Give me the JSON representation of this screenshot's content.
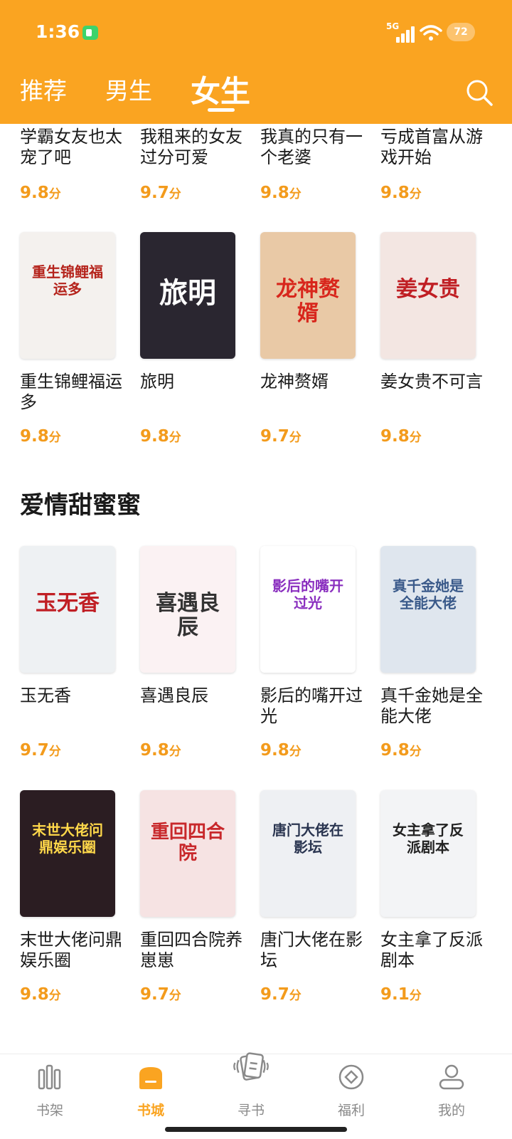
{
  "status": {
    "time": "1:36",
    "network": "5G",
    "battery": "72"
  },
  "tabs": [
    {
      "label": "推荐",
      "active": false
    },
    {
      "label": "男生",
      "active": false
    },
    {
      "label": "女生",
      "active": true
    }
  ],
  "books_top": [
    {
      "title": "学霸女友也太宠了吧",
      "score": "9.8",
      "unit": "分"
    },
    {
      "title": "我租来的女友过分可爱",
      "score": "9.7",
      "unit": "分"
    },
    {
      "title": "我真的只有一个老婆",
      "score": "9.8",
      "unit": "分"
    },
    {
      "title": "亏成首富从游戏开始",
      "score": "9.8",
      "unit": "分"
    }
  ],
  "books_row2": [
    {
      "title": "重生锦鲤福运多",
      "cover_text": "重生锦鲤福运多",
      "score": "9.8",
      "unit": "分",
      "cover_bg": "#f4f1ee",
      "cover_color": "#b5241c"
    },
    {
      "title": "旅明",
      "cover_text": "旅明",
      "score": "9.8",
      "unit": "分",
      "cover_bg": "#2a2630",
      "cover_color": "#ffffff"
    },
    {
      "title": "龙神赘婿",
      "cover_text": "龙神赘婿",
      "score": "9.7",
      "unit": "分",
      "cover_bg": "#e9c9a6",
      "cover_color": "#d8261c"
    },
    {
      "title": "姜女贵不可言",
      "cover_text": "姜女贵",
      "score": "9.8",
      "unit": "分",
      "cover_bg": "#f3e6e2",
      "cover_color": "#c01f24"
    }
  ],
  "section": {
    "title": "爱情甜蜜蜜"
  },
  "books_row3": [
    {
      "title": "玉无香",
      "cover_text": "玉无香",
      "score": "9.7",
      "unit": "分",
      "cover_bg": "#eef1f3",
      "cover_color": "#c01f24"
    },
    {
      "title": "喜遇良辰",
      "cover_text": "喜遇良辰",
      "score": "9.8",
      "unit": "分",
      "cover_bg": "#fbf2f3",
      "cover_color": "#333333"
    },
    {
      "title": "影后的嘴开过光",
      "cover_text": "影后的嘴开过光",
      "score": "9.8",
      "unit": "分",
      "cover_bg": "#ffffff",
      "cover_color": "#8a2fbf"
    },
    {
      "title": "真千金她是全能大佬",
      "cover_text": "真千金她是全能大佬",
      "score": "9.8",
      "unit": "分",
      "cover_bg": "#dfe6ee",
      "cover_color": "#3a5a8a"
    }
  ],
  "books_row4": [
    {
      "title": "末世大佬问鼎娱乐圈",
      "cover_text": "末世大佬问鼎娱乐圈",
      "score": "9.8",
      "unit": "分",
      "cover_bg": "#2b1d22",
      "cover_color": "#ffd84a"
    },
    {
      "title": "重回四合院养崽崽",
      "cover_text": "重回四合院",
      "score": "9.7",
      "unit": "分",
      "cover_bg": "#f6e3e3",
      "cover_color": "#c8282b"
    },
    {
      "title": "唐门大佬在影坛",
      "cover_text": "唐门大佬在影坛",
      "score": "9.7",
      "unit": "分",
      "cover_bg": "#eef0f3",
      "cover_color": "#2a3550"
    },
    {
      "title": "女主拿了反派剧本",
      "cover_text": "女主拿了反派剧本",
      "score": "9.1",
      "unit": "分",
      "cover_bg": "#f3f4f6",
      "cover_color": "#222222"
    }
  ],
  "bottom_nav": [
    {
      "label": "书架",
      "icon": "bookshelf-icon",
      "active": false
    },
    {
      "label": "书城",
      "icon": "bookstore-icon",
      "active": true
    },
    {
      "label": "寻书",
      "icon": "find-book-icon",
      "active": false
    },
    {
      "label": "福利",
      "icon": "welfare-icon",
      "active": false
    },
    {
      "label": "我的",
      "icon": "profile-icon",
      "active": false
    }
  ],
  "colors": {
    "accent": "#FAA421",
    "score": "#F39B1C"
  }
}
